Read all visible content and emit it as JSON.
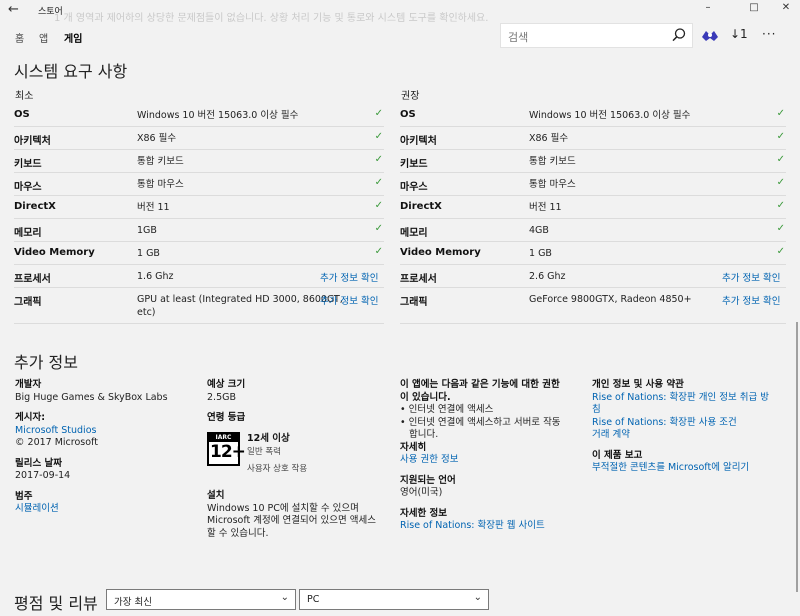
{
  "window": {
    "back_glyph": "←",
    "title": "스토어",
    "faded_text": "1 개 영역과 제어하의 상당한 문제점들이 없습니다. 상황 처리 기능 및 통로와 시스템 도구를 확인하세요.",
    "controls": [
      "–",
      "□",
      "✕"
    ]
  },
  "nav": {
    "tabs": [
      "홈",
      "앱",
      "게임"
    ],
    "active_tab": "게임",
    "search_placeholder": "검색",
    "download_count": "↓1",
    "more": "···"
  },
  "requirements": {
    "heading": "시스템 요구 사항",
    "minimum": {
      "heading": "최소",
      "rows": [
        {
          "label": "OS",
          "value": "Windows 10 버전 15063.0 이상 필수",
          "check": "✓"
        },
        {
          "label": "아키텍처",
          "value": "X86 필수",
          "check": "✓"
        },
        {
          "label": "키보드",
          "value": "통합 키보드",
          "check": "✓"
        },
        {
          "label": "마우스",
          "value": "통합 마우스",
          "check": "✓"
        },
        {
          "label": "DirectX",
          "value": "버전 11",
          "check": "✓"
        },
        {
          "label": "메모리",
          "value": "1GB",
          "check": "✓"
        },
        {
          "label": "Video Memory",
          "value": "1 GB",
          "check": "✓"
        },
        {
          "label": "프로세서",
          "value": "1.6 Ghz",
          "link": "추가 정보 확인"
        },
        {
          "label": "그래픽",
          "value": "GPU at least (Integrated HD 3000, 8600GT,",
          "value2": "etc)",
          "link": "추가 정보 확인"
        }
      ]
    },
    "recommended": {
      "heading": "권장",
      "rows": [
        {
          "label": "OS",
          "value": "Windows 10 버전 15063.0 이상 필수",
          "check": "✓"
        },
        {
          "label": "아키텍처",
          "value": "X86 필수",
          "check": "✓"
        },
        {
          "label": "키보드",
          "value": "통합 키보드",
          "check": "✓"
        },
        {
          "label": "마우스",
          "value": "통합 마우스",
          "check": "✓"
        },
        {
          "label": "DirectX",
          "value": "버전 11",
          "check": "✓"
        },
        {
          "label": "메모리",
          "value": "4GB",
          "check": "✓"
        },
        {
          "label": "Video Memory",
          "value": "1 GB",
          "check": "✓"
        },
        {
          "label": "프로세서",
          "value": "2.6 Ghz",
          "link": "추가 정보 확인"
        },
        {
          "label": "그래픽",
          "value": "GeForce 9800GTX, Radeon 4850+",
          "link": "추가 정보 확인"
        }
      ]
    }
  },
  "additional": {
    "heading": "추가 정보",
    "developer_label": "개발자",
    "developer": "Big Huge Games & SkyBox Labs",
    "publisher_label": "게시자:",
    "publisher": "Microsoft Studios",
    "copyright": "© 2017 Microsoft",
    "release_label": "릴리스 날짜",
    "release_date": "2017-09-14",
    "category_label": "범주",
    "category": "시뮬레이션",
    "size_label": "예상 크기",
    "size": "2.5GB",
    "rating_label": "연령 등급",
    "rating_logo_top": "IARC",
    "rating_logo_num": "12+",
    "rating": "12세 이상",
    "rating_desc": "일반 폭력",
    "rating_interaction": "사용자 상호 작용",
    "install_label": "설치",
    "install_text": [
      "Windows 10 PC에 설치할 수 있으며",
      "Microsoft 계정에 연결되어 있으면 액세스",
      "할 수 있습니다."
    ],
    "capabilities_heading": [
      "이 앱에는 다음과 같은 기능에 대한 권한",
      "이 있습니다."
    ],
    "capabilities": [
      "• 인터넷 연결에 액세스",
      "• 인터넷 연결에 액세스하고 서버로 작동",
      "  합니다."
    ],
    "more_label": "자세히",
    "permissions_link": "사용 권한 정보",
    "languages_label": "지원되는 언어",
    "languages": "영어(미국)",
    "detail_label": "자세한 정보",
    "detail_link": "Rise of Nations: 확장판 웹 사이트",
    "privacy_label": "개인 정보 및 사용 약관",
    "privacy_link": [
      "Rise of Nations: 확장판 개인 정보 취급 방",
      "침"
    ],
    "terms_link": "Rise of Nations: 확장판 사용 조건",
    "contract_link": "거래 계약",
    "report_label": "이 제품 보고",
    "report_link": "부적절한 콘텐츠를 Microsoft에 알리기"
  },
  "reviews": {
    "heading": "평점 및 리뷰",
    "sort": "가장 최신",
    "platform": "PC",
    "chevron": "⌄"
  }
}
